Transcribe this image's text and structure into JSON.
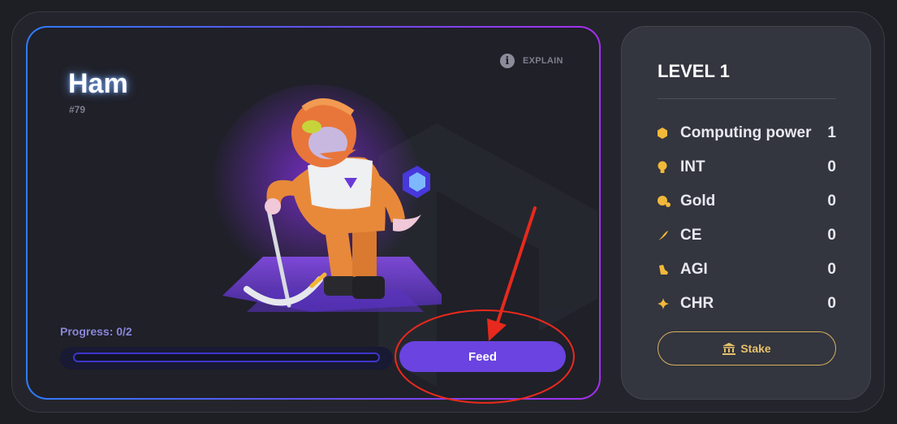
{
  "nft": {
    "name": "Ham",
    "id": "#79",
    "explain_label": "EXPLAIN",
    "explain_icon": "info-icon"
  },
  "progress": {
    "label": "Progress: 0/2",
    "current": 0,
    "total": 2
  },
  "feed_button": {
    "label": "Feed"
  },
  "panel": {
    "level": "LEVEL 1",
    "stats": [
      {
        "name": "Computing power",
        "value": "1",
        "icon": "hexagon-icon"
      },
      {
        "name": "INT",
        "value": "0",
        "icon": "lightbulb-icon"
      },
      {
        "name": "Gold",
        "value": "0",
        "icon": "coin-icon"
      },
      {
        "name": "CE",
        "value": "0",
        "icon": "feather-icon"
      },
      {
        "name": "AGI",
        "value": "0",
        "icon": "boot-icon"
      },
      {
        "name": "CHR",
        "value": "0",
        "icon": "sparkle-icon"
      }
    ],
    "stake_button": {
      "label": "Stake",
      "icon": "bank-icon"
    }
  },
  "colors": {
    "accent_purple": "#6a43e0",
    "gold": "#e6c16a",
    "stat_icon": "#f1b83a",
    "annotation_red": "#e8291d"
  }
}
